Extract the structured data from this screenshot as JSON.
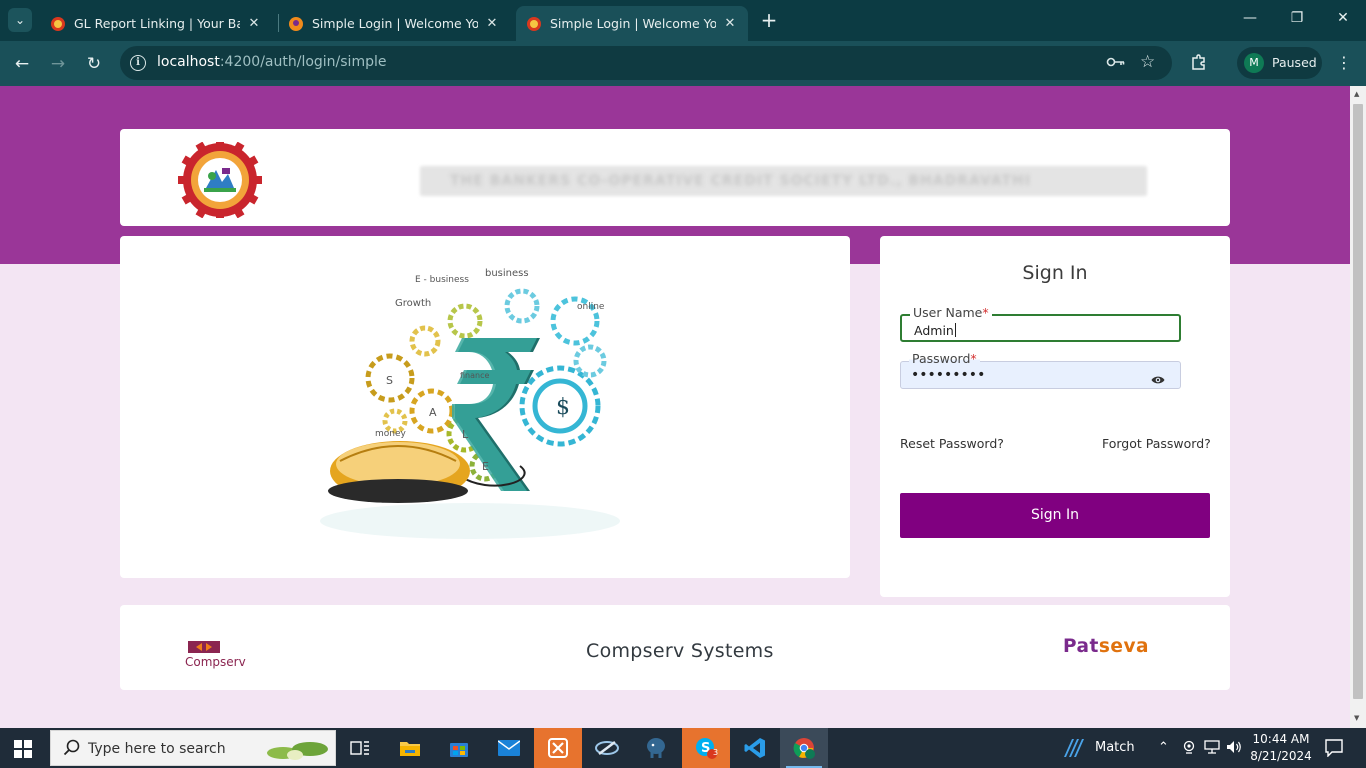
{
  "browser": {
    "tabs": [
      {
        "title": "GL Report Linking | Your Bank N",
        "active": false
      },
      {
        "title": "Simple Login | Welcome Your B",
        "active": false
      },
      {
        "title": "Simple Login | Welcome Your B",
        "active": true
      }
    ],
    "url_host": "localhost",
    "url_path": ":4200/auth/login/simple",
    "profile_initial": "M",
    "profile_status": "Paused"
  },
  "page": {
    "bank_name": "THE BANKERS CO-OPERATIVE CREDIT SOCIETY LTD., BHADRAVATHI",
    "login": {
      "title": "Sign In",
      "username_label": "User Name",
      "username_value": "Admin",
      "password_label": "Password",
      "password_masked": "•••••••••",
      "required_mark": "*",
      "reset_link": "Reset Password?",
      "forgot_link": "Forgot Password?",
      "submit_label": "Sign In"
    },
    "hero_words": [
      "E - business",
      "business",
      "Growth",
      "online",
      "finance",
      "money",
      "S",
      "A",
      "L",
      "E",
      "$"
    ],
    "footer": {
      "left_logo_text": "Compserv",
      "center_text": "Compserv Systems",
      "brand_part1": "Pat",
      "brand_part2": "seva"
    }
  },
  "taskbar": {
    "search_placeholder": "Type here to search",
    "weather_text": "Match",
    "time": "10:44 AM",
    "date": "8/21/2024",
    "skype_badge": "3"
  },
  "colors": {
    "brand_purple": "#9a3698",
    "button_purple": "#800080",
    "chrome_dark": "#0c3b43",
    "chrome_toolbar": "#1a5059"
  }
}
